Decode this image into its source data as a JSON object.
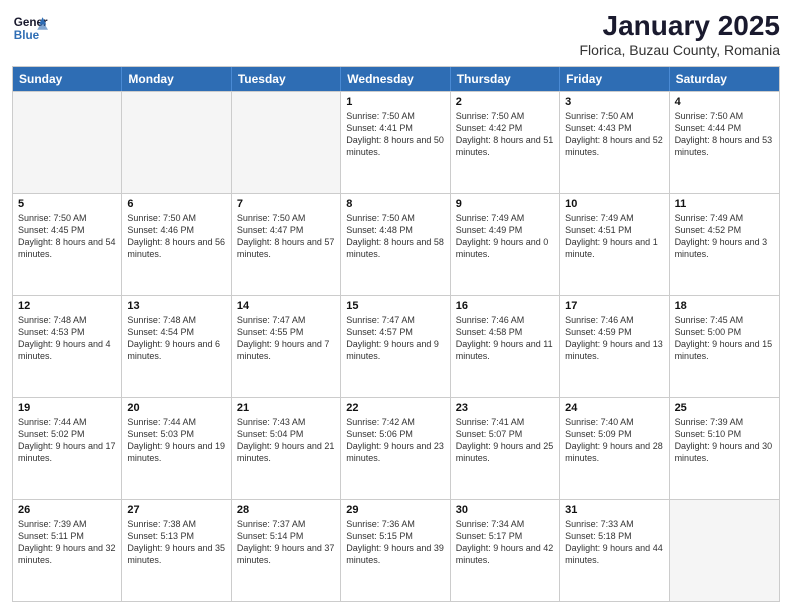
{
  "logo": {
    "general": "General",
    "blue": "Blue"
  },
  "title": "January 2025",
  "subtitle": "Florica, Buzau County, Romania",
  "headers": [
    "Sunday",
    "Monday",
    "Tuesday",
    "Wednesday",
    "Thursday",
    "Friday",
    "Saturday"
  ],
  "weeks": [
    [
      {
        "day": "",
        "sunrise": "",
        "sunset": "",
        "daylight": "",
        "empty": true
      },
      {
        "day": "",
        "sunrise": "",
        "sunset": "",
        "daylight": "",
        "empty": true
      },
      {
        "day": "",
        "sunrise": "",
        "sunset": "",
        "daylight": "",
        "empty": true
      },
      {
        "day": "1",
        "sunrise": "Sunrise: 7:50 AM",
        "sunset": "Sunset: 4:41 PM",
        "daylight": "Daylight: 8 hours and 50 minutes."
      },
      {
        "day": "2",
        "sunrise": "Sunrise: 7:50 AM",
        "sunset": "Sunset: 4:42 PM",
        "daylight": "Daylight: 8 hours and 51 minutes."
      },
      {
        "day": "3",
        "sunrise": "Sunrise: 7:50 AM",
        "sunset": "Sunset: 4:43 PM",
        "daylight": "Daylight: 8 hours and 52 minutes."
      },
      {
        "day": "4",
        "sunrise": "Sunrise: 7:50 AM",
        "sunset": "Sunset: 4:44 PM",
        "daylight": "Daylight: 8 hours and 53 minutes."
      }
    ],
    [
      {
        "day": "5",
        "sunrise": "Sunrise: 7:50 AM",
        "sunset": "Sunset: 4:45 PM",
        "daylight": "Daylight: 8 hours and 54 minutes."
      },
      {
        "day": "6",
        "sunrise": "Sunrise: 7:50 AM",
        "sunset": "Sunset: 4:46 PM",
        "daylight": "Daylight: 8 hours and 56 minutes."
      },
      {
        "day": "7",
        "sunrise": "Sunrise: 7:50 AM",
        "sunset": "Sunset: 4:47 PM",
        "daylight": "Daylight: 8 hours and 57 minutes."
      },
      {
        "day": "8",
        "sunrise": "Sunrise: 7:50 AM",
        "sunset": "Sunset: 4:48 PM",
        "daylight": "Daylight: 8 hours and 58 minutes."
      },
      {
        "day": "9",
        "sunrise": "Sunrise: 7:49 AM",
        "sunset": "Sunset: 4:49 PM",
        "daylight": "Daylight: 9 hours and 0 minutes."
      },
      {
        "day": "10",
        "sunrise": "Sunrise: 7:49 AM",
        "sunset": "Sunset: 4:51 PM",
        "daylight": "Daylight: 9 hours and 1 minute."
      },
      {
        "day": "11",
        "sunrise": "Sunrise: 7:49 AM",
        "sunset": "Sunset: 4:52 PM",
        "daylight": "Daylight: 9 hours and 3 minutes."
      }
    ],
    [
      {
        "day": "12",
        "sunrise": "Sunrise: 7:48 AM",
        "sunset": "Sunset: 4:53 PM",
        "daylight": "Daylight: 9 hours and 4 minutes."
      },
      {
        "day": "13",
        "sunrise": "Sunrise: 7:48 AM",
        "sunset": "Sunset: 4:54 PM",
        "daylight": "Daylight: 9 hours and 6 minutes."
      },
      {
        "day": "14",
        "sunrise": "Sunrise: 7:47 AM",
        "sunset": "Sunset: 4:55 PM",
        "daylight": "Daylight: 9 hours and 7 minutes."
      },
      {
        "day": "15",
        "sunrise": "Sunrise: 7:47 AM",
        "sunset": "Sunset: 4:57 PM",
        "daylight": "Daylight: 9 hours and 9 minutes."
      },
      {
        "day": "16",
        "sunrise": "Sunrise: 7:46 AM",
        "sunset": "Sunset: 4:58 PM",
        "daylight": "Daylight: 9 hours and 11 minutes."
      },
      {
        "day": "17",
        "sunrise": "Sunrise: 7:46 AM",
        "sunset": "Sunset: 4:59 PM",
        "daylight": "Daylight: 9 hours and 13 minutes."
      },
      {
        "day": "18",
        "sunrise": "Sunrise: 7:45 AM",
        "sunset": "Sunset: 5:00 PM",
        "daylight": "Daylight: 9 hours and 15 minutes."
      }
    ],
    [
      {
        "day": "19",
        "sunrise": "Sunrise: 7:44 AM",
        "sunset": "Sunset: 5:02 PM",
        "daylight": "Daylight: 9 hours and 17 minutes."
      },
      {
        "day": "20",
        "sunrise": "Sunrise: 7:44 AM",
        "sunset": "Sunset: 5:03 PM",
        "daylight": "Daylight: 9 hours and 19 minutes."
      },
      {
        "day": "21",
        "sunrise": "Sunrise: 7:43 AM",
        "sunset": "Sunset: 5:04 PM",
        "daylight": "Daylight: 9 hours and 21 minutes."
      },
      {
        "day": "22",
        "sunrise": "Sunrise: 7:42 AM",
        "sunset": "Sunset: 5:06 PM",
        "daylight": "Daylight: 9 hours and 23 minutes."
      },
      {
        "day": "23",
        "sunrise": "Sunrise: 7:41 AM",
        "sunset": "Sunset: 5:07 PM",
        "daylight": "Daylight: 9 hours and 25 minutes."
      },
      {
        "day": "24",
        "sunrise": "Sunrise: 7:40 AM",
        "sunset": "Sunset: 5:09 PM",
        "daylight": "Daylight: 9 hours and 28 minutes."
      },
      {
        "day": "25",
        "sunrise": "Sunrise: 7:39 AM",
        "sunset": "Sunset: 5:10 PM",
        "daylight": "Daylight: 9 hours and 30 minutes."
      }
    ],
    [
      {
        "day": "26",
        "sunrise": "Sunrise: 7:39 AM",
        "sunset": "Sunset: 5:11 PM",
        "daylight": "Daylight: 9 hours and 32 minutes."
      },
      {
        "day": "27",
        "sunrise": "Sunrise: 7:38 AM",
        "sunset": "Sunset: 5:13 PM",
        "daylight": "Daylight: 9 hours and 35 minutes."
      },
      {
        "day": "28",
        "sunrise": "Sunrise: 7:37 AM",
        "sunset": "Sunset: 5:14 PM",
        "daylight": "Daylight: 9 hours and 37 minutes."
      },
      {
        "day": "29",
        "sunrise": "Sunrise: 7:36 AM",
        "sunset": "Sunset: 5:15 PM",
        "daylight": "Daylight: 9 hours and 39 minutes."
      },
      {
        "day": "30",
        "sunrise": "Sunrise: 7:34 AM",
        "sunset": "Sunset: 5:17 PM",
        "daylight": "Daylight: 9 hours and 42 minutes."
      },
      {
        "day": "31",
        "sunrise": "Sunrise: 7:33 AM",
        "sunset": "Sunset: 5:18 PM",
        "daylight": "Daylight: 9 hours and 44 minutes."
      },
      {
        "day": "",
        "sunrise": "",
        "sunset": "",
        "daylight": "",
        "empty": true
      }
    ]
  ]
}
